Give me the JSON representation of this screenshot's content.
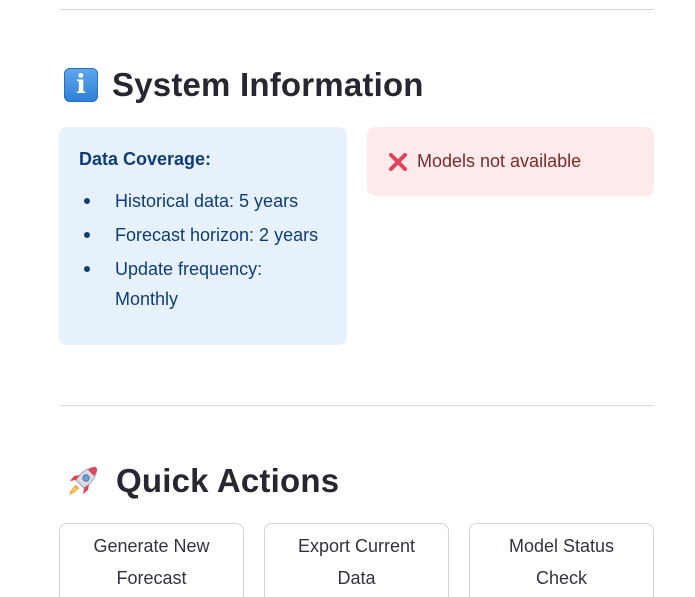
{
  "system_info": {
    "icon": "information-icon",
    "title": "System Information",
    "data_coverage": {
      "heading": "Data Coverage:",
      "items": [
        "Historical data: 5 years",
        "Forecast horizon: 2 years",
        "Update frequency: Monthly"
      ]
    },
    "model_status": {
      "icon": "cross-mark-icon",
      "text": "Models not available",
      "color": "#fdeaea"
    }
  },
  "quick_actions": {
    "icon": "rocket-icon",
    "title": "Quick Actions",
    "buttons": [
      "Generate New Forecast",
      "Export Current Data",
      "Model Status Check"
    ]
  },
  "colors": {
    "info_bg": "#e7f1fb",
    "info_text": "#0f3d75",
    "error_bg": "#fdeaea",
    "error_text": "#7d2a2a",
    "divider": "#d9d9de"
  }
}
